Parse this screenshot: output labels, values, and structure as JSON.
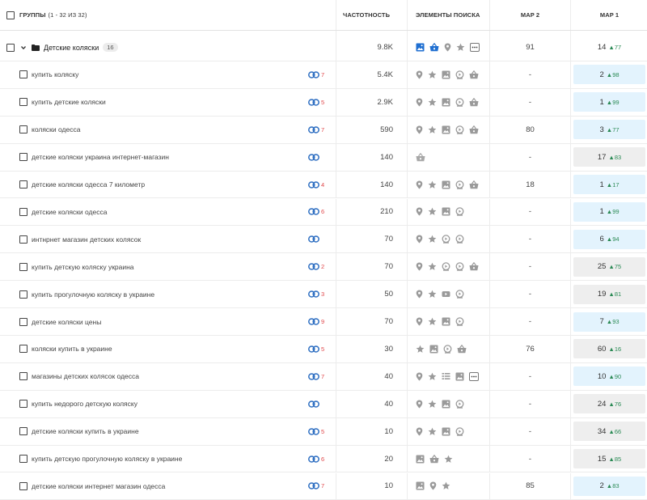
{
  "header": {
    "groups_label": "ГРУППЫ",
    "groups_count": "(1 - 32 ИЗ 32)",
    "frequency": "ЧАСТОТНОСТЬ",
    "search_elements": "ЭЛЕМЕНТЫ ПОИСКА",
    "map2": "MAP 2",
    "map1": "MAP 1"
  },
  "group": {
    "name": "Детские коляски",
    "count": "16",
    "frequency": "9.8K",
    "features": [
      "image-icon",
      "shopping-icon",
      "location-icon",
      "star-icon",
      "more-icon"
    ],
    "map2": "91",
    "map1": "14",
    "map1_delta": "77",
    "map1_color": "none"
  },
  "rows": [
    {
      "keyword": "купить коляску",
      "links": "7",
      "link_color": "#e0484b",
      "frequency": "5.4K",
      "features": [
        "location-icon",
        "star-icon",
        "image-icon",
        "video-carousel-icon",
        "shopping-icon"
      ],
      "map2": "-",
      "map1": "2",
      "map1_delta": "98",
      "map1_color": "blue"
    },
    {
      "keyword": "купить детские коляски",
      "links": "5",
      "link_color": "#e0484b",
      "frequency": "2.9K",
      "features": [
        "location-icon",
        "star-icon",
        "image-icon",
        "video-carousel-icon",
        "shopping-icon"
      ],
      "map2": "-",
      "map1": "1",
      "map1_delta": "99",
      "map1_color": "blue"
    },
    {
      "keyword": "коляски одесса",
      "links": "7",
      "link_color": "#e0484b",
      "frequency": "590",
      "features": [
        "location-icon",
        "star-icon",
        "image-icon",
        "video-carousel-icon",
        "shopping-icon"
      ],
      "map2": "80",
      "map1": "3",
      "map1_delta": "77",
      "map1_color": "blue"
    },
    {
      "keyword": "детские коляски украина интернет-магазин",
      "links": "",
      "link_color": "#e0484b",
      "frequency": "140",
      "features": [
        "shopping-gray-icon"
      ],
      "map2": "-",
      "map1": "17",
      "map1_delta": "83",
      "map1_color": "gray"
    },
    {
      "keyword": "детские коляски одесса 7 километр",
      "links": "4",
      "link_color": "#e0484b",
      "frequency": "140",
      "features": [
        "location-icon",
        "star-icon",
        "image-icon",
        "video-carousel-icon",
        "shopping-icon"
      ],
      "map2": "18",
      "map1": "1",
      "map1_delta": "17",
      "map1_color": "blue"
    },
    {
      "keyword": "детские коляски одесса",
      "links": "6",
      "link_color": "#e0484b",
      "frequency": "210",
      "features": [
        "location-icon",
        "star-icon",
        "image-icon",
        "video-carousel-icon"
      ],
      "map2": "-",
      "map1": "1",
      "map1_delta": "99",
      "map1_color": "blue"
    },
    {
      "keyword": "интнрнет магазин детских колясок",
      "links": "",
      "link_color": "#e0484b",
      "frequency": "70",
      "features": [
        "location-icon",
        "star-icon",
        "video-carousel-icon",
        "video-carousel-icon"
      ],
      "map2": "-",
      "map1": "6",
      "map1_delta": "94",
      "map1_color": "blue"
    },
    {
      "keyword": "купить детскую коляску украина",
      "links": "2",
      "link_color": "#e0484b",
      "frequency": "70",
      "features": [
        "location-icon",
        "star-icon",
        "video-carousel-icon",
        "video-carousel-icon",
        "shopping-icon"
      ],
      "map2": "-",
      "map1": "25",
      "map1_delta": "75",
      "map1_color": "gray"
    },
    {
      "keyword": "купить прогулочную коляску в украине",
      "links": "3",
      "link_color": "#e0484b",
      "frequency": "50",
      "features": [
        "location-icon",
        "star-icon",
        "youtube-icon",
        "video-carousel-icon"
      ],
      "map2": "-",
      "map1": "19",
      "map1_delta": "81",
      "map1_color": "gray"
    },
    {
      "keyword": "детские коляски цены",
      "links": "9",
      "link_color": "#e0484b",
      "frequency": "70",
      "features": [
        "location-icon",
        "star-icon",
        "image-icon",
        "video-carousel-icon"
      ],
      "map2": "-",
      "map1": "7",
      "map1_delta": "93",
      "map1_color": "blue"
    },
    {
      "keyword": "коляски купить в украине",
      "links": "5",
      "link_color": "#e0484b",
      "frequency": "30",
      "features": [
        "star-icon",
        "image-icon",
        "video-carousel-icon",
        "shopping-icon"
      ],
      "map2": "76",
      "map1": "60",
      "map1_delta": "16",
      "map1_color": "gray"
    },
    {
      "keyword": "магазины детских колясок одесса",
      "links": "7",
      "link_color": "#e0484b",
      "frequency": "40",
      "features": [
        "location-icon",
        "star-icon",
        "list-icon",
        "image-icon",
        "more-icon"
      ],
      "map2": "-",
      "map1": "10",
      "map1_delta": "90",
      "map1_color": "blue"
    },
    {
      "keyword": "купить недорого детскую коляску",
      "links": "",
      "link_color": "#e0484b",
      "frequency": "40",
      "features": [
        "location-icon",
        "star-icon",
        "image-icon",
        "video-carousel-icon"
      ],
      "map2": "-",
      "map1": "24",
      "map1_delta": "76",
      "map1_color": "gray"
    },
    {
      "keyword": "детские коляски купить в украине",
      "links": "5",
      "link_color": "#e0484b",
      "frequency": "10",
      "features": [
        "location-icon",
        "star-icon",
        "image-icon",
        "video-carousel-icon"
      ],
      "map2": "-",
      "map1": "34",
      "map1_delta": "66",
      "map1_color": "gray"
    },
    {
      "keyword": "купить детскую прогулочную коляску в украине",
      "links": "6",
      "link_color": "#e0484b",
      "frequency": "20",
      "features": [
        "image-icon",
        "shopping-icon",
        "star-icon"
      ],
      "map2": "-",
      "map1": "15",
      "map1_delta": "85",
      "map1_color": "gray"
    },
    {
      "keyword": "детские коляски интернет магазин одесса",
      "links": "7",
      "link_color": "#e0484b",
      "frequency": "10",
      "features": [
        "image-icon",
        "location-icon",
        "star-icon"
      ],
      "map2": "85",
      "map1": "2",
      "map1_delta": "83",
      "map1_color": "blue"
    }
  ],
  "colors": {
    "link_icon": "#2f6fc2",
    "feature_gray": "#9a9a9a",
    "feature_blue": "#1f6fd1",
    "map1_blue_bg": "#e3f3fd",
    "map1_gray_bg": "#eeeeee",
    "delta_green": "#2b8a55",
    "link_count_red": "#e0484b"
  }
}
